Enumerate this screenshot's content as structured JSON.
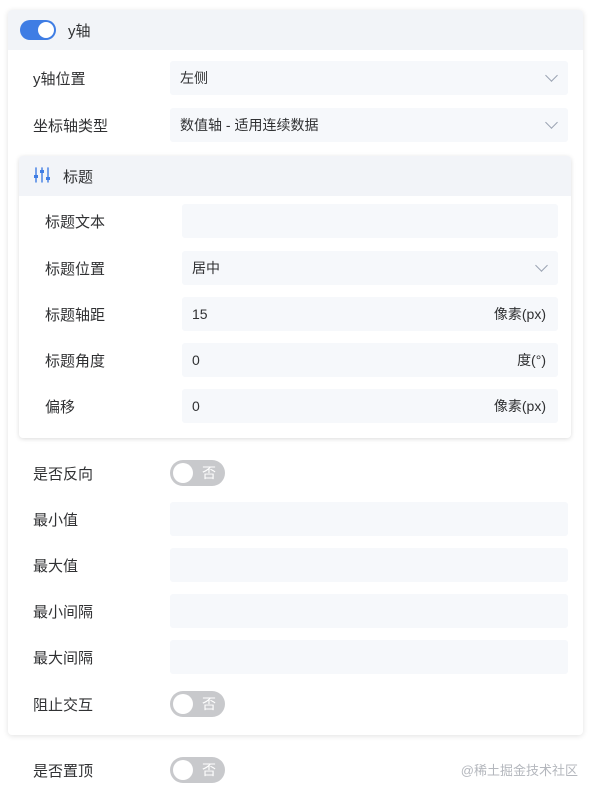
{
  "panel": {
    "title": "y轴",
    "enabled": true,
    "accent_color": "#3f7de4",
    "rows": {
      "position": {
        "label": "y轴位置",
        "value": "左侧"
      },
      "axis_type": {
        "label": "坐标轴类型",
        "value": "数值轴 - 适用连续数据"
      }
    }
  },
  "title_section": {
    "title": "标题",
    "icon": "sliders-icon",
    "text": {
      "label": "标题文本",
      "value": ""
    },
    "position": {
      "label": "标题位置",
      "value": "居中"
    },
    "distance": {
      "label": "标题轴距",
      "value": "15",
      "unit": "像素(px)"
    },
    "angle": {
      "label": "标题角度",
      "value": "0",
      "unit": "度(°)"
    },
    "offset": {
      "label": "偏移",
      "value": "0",
      "unit": "像素(px)"
    }
  },
  "options": {
    "reverse": {
      "label": "是否反向",
      "toggle_text": "否"
    },
    "min": {
      "label": "最小值",
      "value": ""
    },
    "max": {
      "label": "最大值",
      "value": ""
    },
    "min_interval": {
      "label": "最小间隔",
      "value": ""
    },
    "max_interval": {
      "label": "最大间隔",
      "value": ""
    },
    "block_interaction": {
      "label": "阻止交互",
      "toggle_text": "否"
    }
  },
  "pin_top": {
    "label": "是否置顶",
    "toggle_text": "否"
  },
  "watermark": "@稀土掘金技术社区"
}
